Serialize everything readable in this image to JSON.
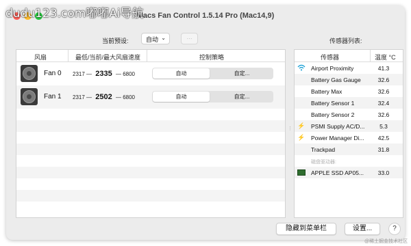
{
  "watermark": "dudu123.com嘟嘟Ai导航",
  "window": {
    "title": "Macs Fan Control 1.5.14 Pro (Mac14,9)"
  },
  "toolbar": {
    "preset_label": "当前预设:",
    "preset_value": "自动",
    "more_icon": "ellipsis-icon",
    "sensor_list_label": "传感器列表:"
  },
  "fan_table": {
    "headers": {
      "fan": "风扇",
      "speed": "最低/当前/最大风扇速度",
      "control": "控制策略"
    },
    "rows": [
      {
        "name": "Fan 0",
        "min": "2317",
        "current": "2335",
        "max": "6800",
        "auto_label": "自动",
        "custom_label": "自定..."
      },
      {
        "name": "Fan 1",
        "min": "2317",
        "current": "2502",
        "max": "6800",
        "auto_label": "自动",
        "custom_label": "自定..."
      }
    ]
  },
  "sensor_table": {
    "headers": {
      "sensor": "传感器",
      "temp": "温度 °C"
    },
    "rows": [
      {
        "icon": "wifi-icon",
        "name": "Airport Proximity",
        "value": "41.3"
      },
      {
        "icon": "none",
        "name": "Battery Gas Gauge",
        "value": "32.6"
      },
      {
        "icon": "none",
        "name": "Battery Max",
        "value": "32.6"
      },
      {
        "icon": "none",
        "name": "Battery Sensor 1",
        "value": "32.4"
      },
      {
        "icon": "none",
        "name": "Battery Sensor 2",
        "value": "32.6"
      },
      {
        "icon": "bolt-icon",
        "name": "PSMI Supply AC/D...",
        "value": "5.3"
      },
      {
        "icon": "bolt-icon",
        "name": "Power Manager Di...",
        "value": "42.5"
      },
      {
        "icon": "none",
        "name": "Trackpad",
        "value": "31.8"
      }
    ],
    "group_label": "磁盘驱动器:",
    "disk_rows": [
      {
        "icon": "ssd-icon",
        "name": "APPLE SSD AP05...",
        "value": "33.0"
      }
    ]
  },
  "buttons": {
    "hide": "隐藏到菜单栏",
    "settings": "设置...",
    "help": "?"
  },
  "credit": "@稀土掘金技术社区",
  "colors": {
    "close": "#ff5f57",
    "minimize": "#febc2e",
    "maximize": "#28c840",
    "wifi": "#1aa0d6",
    "bolt": "#e6a800"
  }
}
